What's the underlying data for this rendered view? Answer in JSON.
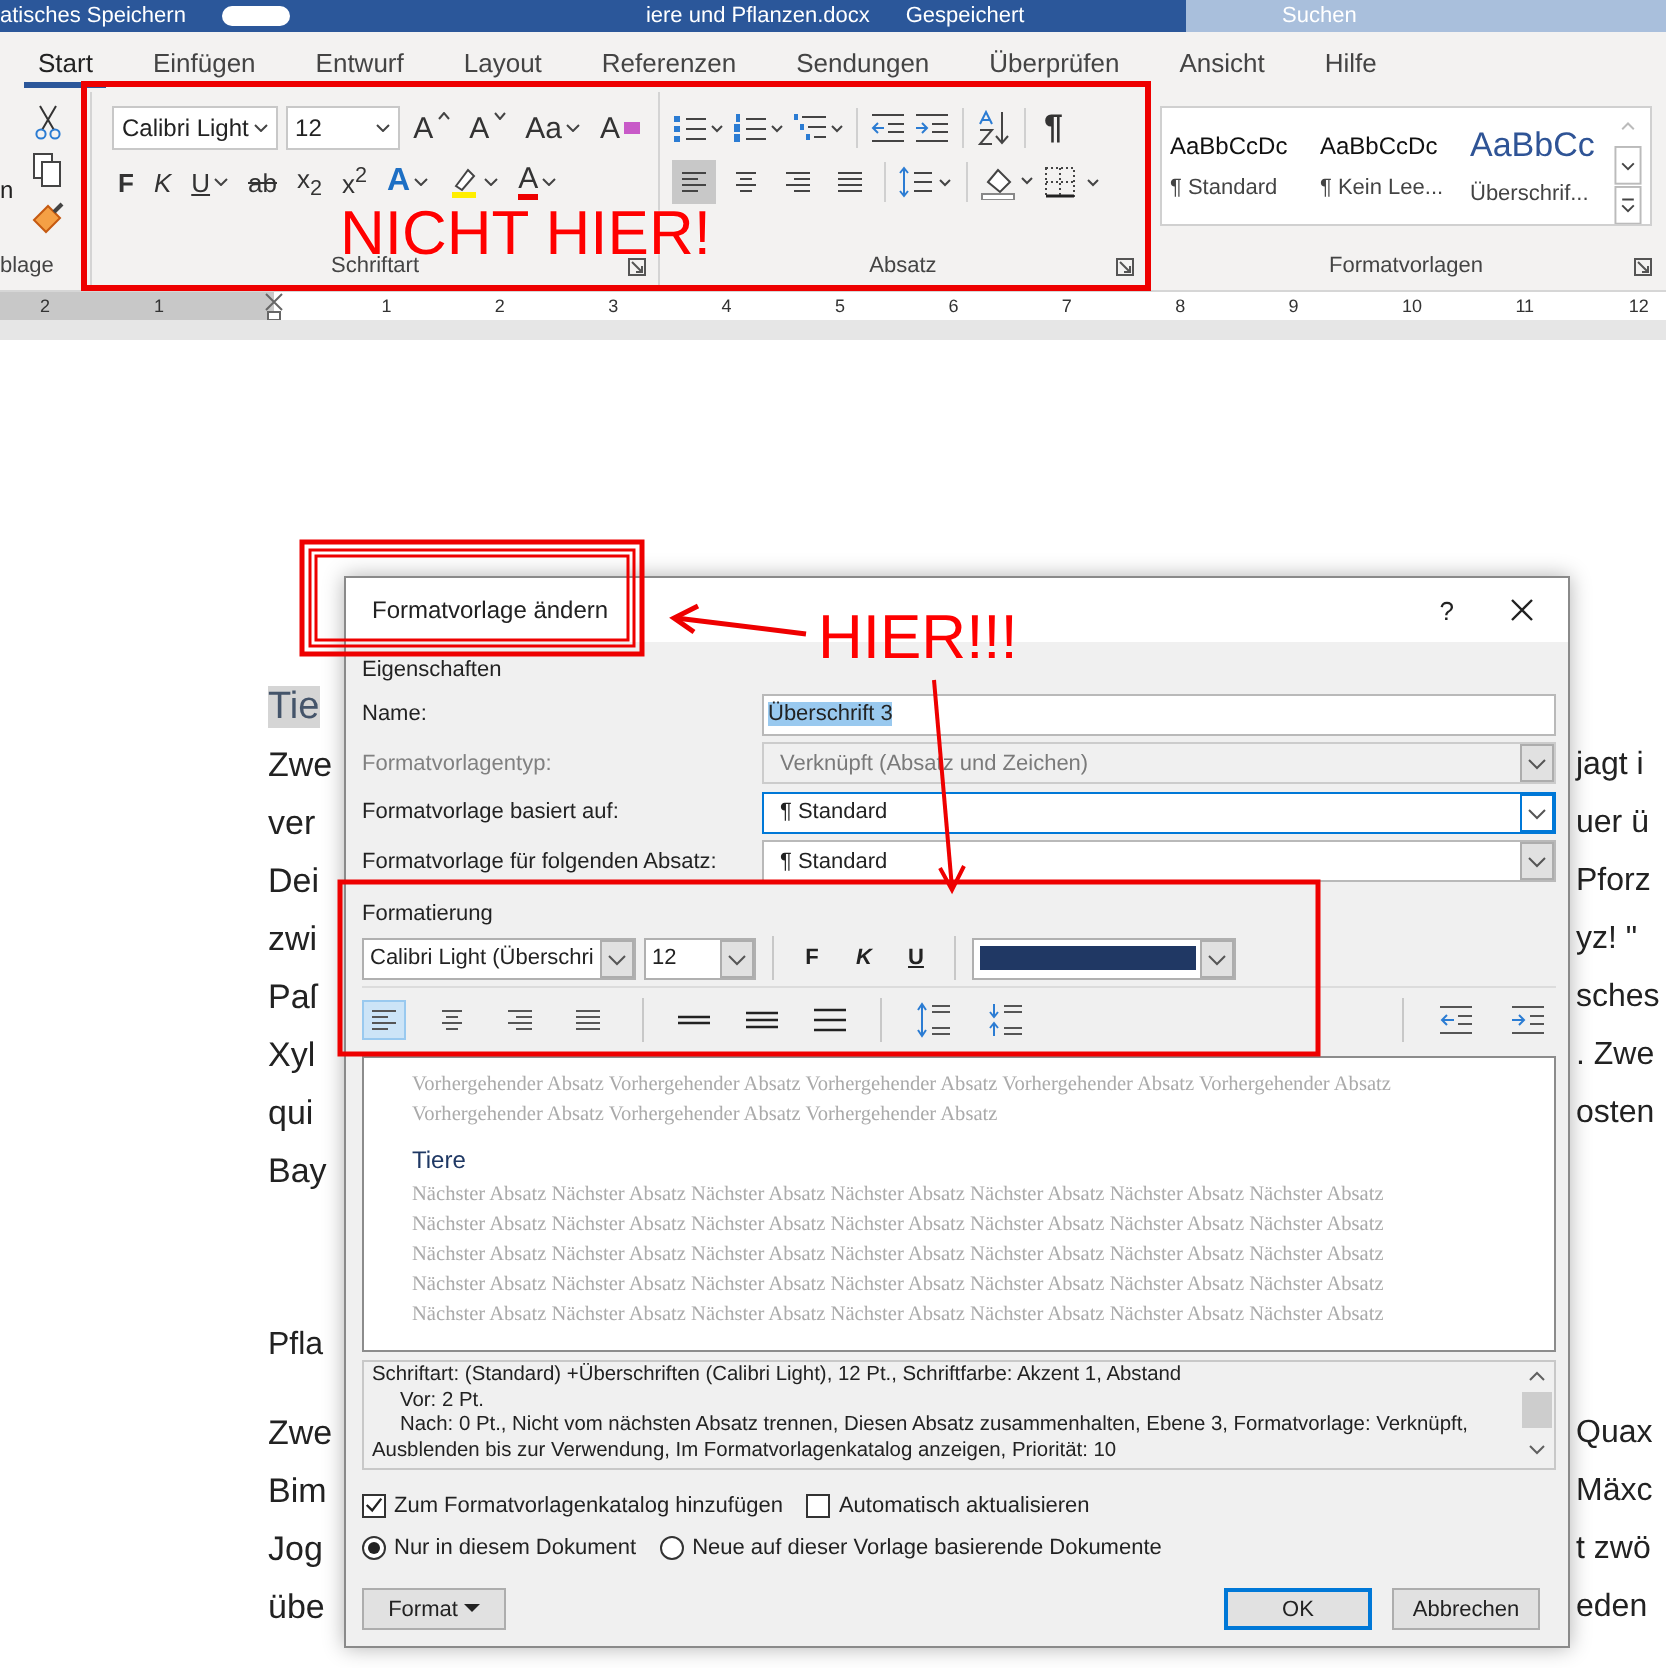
{
  "title_bar": {
    "autosave": "atisches Speichern",
    "document": "iere und Pflanzen.docx",
    "status": "Gespeichert",
    "search_placeholder": "Suchen"
  },
  "tabs": [
    {
      "label": "Start",
      "selected": true
    },
    {
      "label": "Einfügen",
      "selected": false
    },
    {
      "label": "Entwurf",
      "selected": false
    },
    {
      "label": "Layout",
      "selected": false
    },
    {
      "label": "Referenzen",
      "selected": false
    },
    {
      "label": "Sendungen",
      "selected": false
    },
    {
      "label": "Überprüfen",
      "selected": false
    },
    {
      "label": "Ansicht",
      "selected": false
    },
    {
      "label": "Hilfe",
      "selected": false
    }
  ],
  "ribbon": {
    "clipboard": {
      "paste_label": "n",
      "group_label": "blage"
    },
    "font": {
      "font_name": "Calibri Light",
      "font_size": "12",
      "group_label": "Schriftart",
      "row1_tools": [
        {
          "kind": "grow",
          "label": "A"
        },
        {
          "kind": "shrink",
          "label": "A"
        },
        {
          "kind": "case",
          "label": "Aa"
        },
        {
          "kind": "clear",
          "label": "A"
        }
      ],
      "row2_tools": [
        {
          "kind": "bold",
          "label": "F"
        },
        {
          "kind": "italic",
          "label": "K"
        },
        {
          "kind": "underline",
          "label": "U"
        },
        {
          "kind": "strike",
          "label": "ab"
        },
        {
          "kind": "subscript",
          "label": "x$_{2}$"
        },
        {
          "kind": "superscript",
          "label": "x$^{2}$"
        },
        {
          "kind": "effects",
          "label": "A"
        },
        {
          "kind": "highlight"
        },
        {
          "kind": "color",
          "label": "A"
        }
      ]
    },
    "paragraph": {
      "group_label": "Absatz",
      "pilcrow": "¶",
      "alignments": [
        {
          "kind": "left",
          "selected": true
        },
        {
          "kind": "center",
          "selected": false
        },
        {
          "kind": "right",
          "selected": false
        },
        {
          "kind": "justify",
          "selected": false
        }
      ]
    },
    "styles": {
      "group_label": "Formatvorlagen",
      "items": [
        {
          "kind": "normal",
          "preview": "AaBbCcDc",
          "name": "¶ Standard"
        },
        {
          "kind": "normal",
          "preview": "AaBbCcDc",
          "name": "¶ Kein Lee..."
        },
        {
          "kind": "heading",
          "preview": "AaBbCc",
          "name": "Überschrif..."
        }
      ]
    }
  },
  "ruler": {
    "left_numbers": [
      "2",
      "1"
    ],
    "right_numbers": [
      "1",
      "2",
      "3",
      "4",
      "5",
      "6",
      "7",
      "8",
      "9",
      "10",
      "11",
      "12"
    ]
  },
  "document": {
    "lines": [
      {
        "kind": "highlighted-heading",
        "left": "Tie"
      },
      {
        "kind": "text",
        "left": "Zwe",
        "right": "jagt i"
      },
      {
        "kind": "text",
        "left": "ver",
        "right": "uer ü"
      },
      {
        "kind": "text",
        "left": "Dei",
        "right": "Pforz"
      },
      {
        "kind": "text",
        "left": "zwi",
        "right": "yz! \""
      },
      {
        "kind": "text",
        "left": "Paſ",
        "right": "sches"
      },
      {
        "kind": "text",
        "left": "Xyl",
        "right": ". Zwe"
      },
      {
        "kind": "text",
        "left": "qui",
        "right": "osten"
      },
      {
        "kind": "text",
        "left": "Bay"
      },
      {
        "kind": "blank"
      },
      {
        "kind": "blank"
      },
      {
        "kind": "heading",
        "left": "Pfla"
      },
      {
        "kind": "text",
        "left": "Zwe",
        "right": "Quax"
      },
      {
        "kind": "text",
        "left": "Bim",
        "right": "Mäxc"
      },
      {
        "kind": "text",
        "left": "Jog",
        "right": "t zwö"
      },
      {
        "kind": "text",
        "left": "übe",
        "right": "eden"
      }
    ]
  },
  "dialog": {
    "title": "Formatvorlage ändern",
    "help": "?",
    "properties_label": "Eigenschaften",
    "fields": [
      {
        "kind": "text",
        "label": "Name:",
        "value": "Überschrift 3",
        "disabled": false,
        "highlighted": true,
        "focused": false
      },
      {
        "kind": "dropdown",
        "label": "Formatvorlagentyp:",
        "value": "Verknüpft (Absatz und Zeichen)",
        "disabled": true,
        "highlighted": false,
        "focused": false
      },
      {
        "kind": "dropdown",
        "label": "Formatvorlage basiert auf:",
        "value": "¶  Standard",
        "disabled": false,
        "highlighted": false,
        "focused": true
      },
      {
        "kind": "dropdown",
        "label": "Formatvorlage für folgenden Absatz:",
        "value": "¶  Standard",
        "disabled": false,
        "highlighted": false,
        "focused": false
      }
    ],
    "formatting": {
      "label": "Formatierung",
      "font": "Calibri Light (Überschri",
      "size": "12",
      "style_buttons": [
        "F",
        "K",
        "U"
      ],
      "alignments": [
        {
          "kind": "left",
          "selected": true
        },
        {
          "kind": "center",
          "selected": false
        },
        {
          "kind": "right",
          "selected": false
        },
        {
          "kind": "justify",
          "selected": false
        }
      ]
    },
    "preview": {
      "previous": "Vorhergehender Absatz Vorhergehender Absatz Vorhergehender Absatz Vorhergehender Absatz Vorhergehender Absatz Vorhergehender Absatz Vorhergehender Absatz Vorhergehender Absatz",
      "heading": "Tiere",
      "next": "Nächster Absatz Nächster Absatz Nächster Absatz Nächster Absatz Nächster Absatz Nächster Absatz Nächster Absatz Nächster Absatz Nächster Absatz Nächster Absatz Nächster Absatz Nächster Absatz Nächster Absatz Nächster Absatz Nächster Absatz Nächster Absatz Nächster Absatz Nächster Absatz Nächster Absatz Nächster Absatz Nächster Absatz Nächster Absatz Nächster Absatz Nächster Absatz Nächster Absatz Nächster Absatz Nächster Absatz Nächster Absatz Nächster Absatz Nächster Absatz Nächster Absatz Nächster Absatz Nächster Absatz Nächster Absatz Nächster Absatz"
    },
    "description": [
      "Schriftart: (Standard) +Überschriften (Calibri Light), 12 Pt., Schriftfarbe: Akzent 1, Abstand",
      "Vor:  2 Pt.",
      "Nach:  0 Pt., Nicht vom nächsten Absatz trennen, Diesen Absatz zusammenhalten, Ebene 3, Formatvorlage: Verknüpft, Ausblenden bis zur Verwendung, Im Formatvorlagenkatalog anzeigen, Priorität: 10"
    ],
    "checkboxes": [
      {
        "label": "Zum Formatvorlagenkatalog hinzufügen",
        "checked": true
      },
      {
        "label": "Automatisch aktualisieren",
        "checked": false
      }
    ],
    "radios": [
      {
        "label": "Nur in diesem Dokument",
        "selected": true
      },
      {
        "label": "Neue auf dieser Vorlage basierende Dokumente",
        "selected": false
      }
    ],
    "format_button": "Format",
    "ok_button": "OK",
    "cancel_button": "Abbrechen"
  },
  "annotations": [
    {
      "kind": "wrong",
      "text": "NICHT HIER!"
    },
    {
      "kind": "right",
      "text": "HIER!!!"
    }
  ]
}
